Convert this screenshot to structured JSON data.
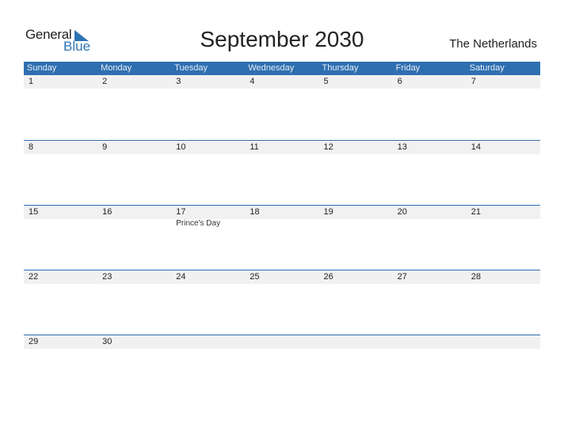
{
  "logo": {
    "general": "General",
    "blue": "Blue"
  },
  "title": "September 2030",
  "country": "The Netherlands",
  "weekdays": [
    "Sunday",
    "Monday",
    "Tuesday",
    "Wednesday",
    "Thursday",
    "Friday",
    "Saturday"
  ],
  "weeks": [
    {
      "days": [
        "1",
        "2",
        "3",
        "4",
        "5",
        "6",
        "7"
      ],
      "events": [
        "",
        "",
        "",
        "",
        "",
        "",
        ""
      ]
    },
    {
      "days": [
        "8",
        "9",
        "10",
        "11",
        "12",
        "13",
        "14"
      ],
      "events": [
        "",
        "",
        "",
        "",
        "",
        "",
        ""
      ]
    },
    {
      "days": [
        "15",
        "16",
        "17",
        "18",
        "19",
        "20",
        "21"
      ],
      "events": [
        "",
        "",
        "Prince's Day",
        "",
        "",
        "",
        ""
      ]
    },
    {
      "days": [
        "22",
        "23",
        "24",
        "25",
        "26",
        "27",
        "28"
      ],
      "events": [
        "",
        "",
        "",
        "",
        "",
        "",
        ""
      ]
    },
    {
      "days": [
        "29",
        "30",
        "",
        "",
        "",
        "",
        ""
      ],
      "events": [
        "",
        "",
        "",
        "",
        "",
        "",
        ""
      ]
    }
  ],
  "colors": {
    "accent": "#2e6fb0",
    "date_row_bg": "#f1f1f1"
  }
}
